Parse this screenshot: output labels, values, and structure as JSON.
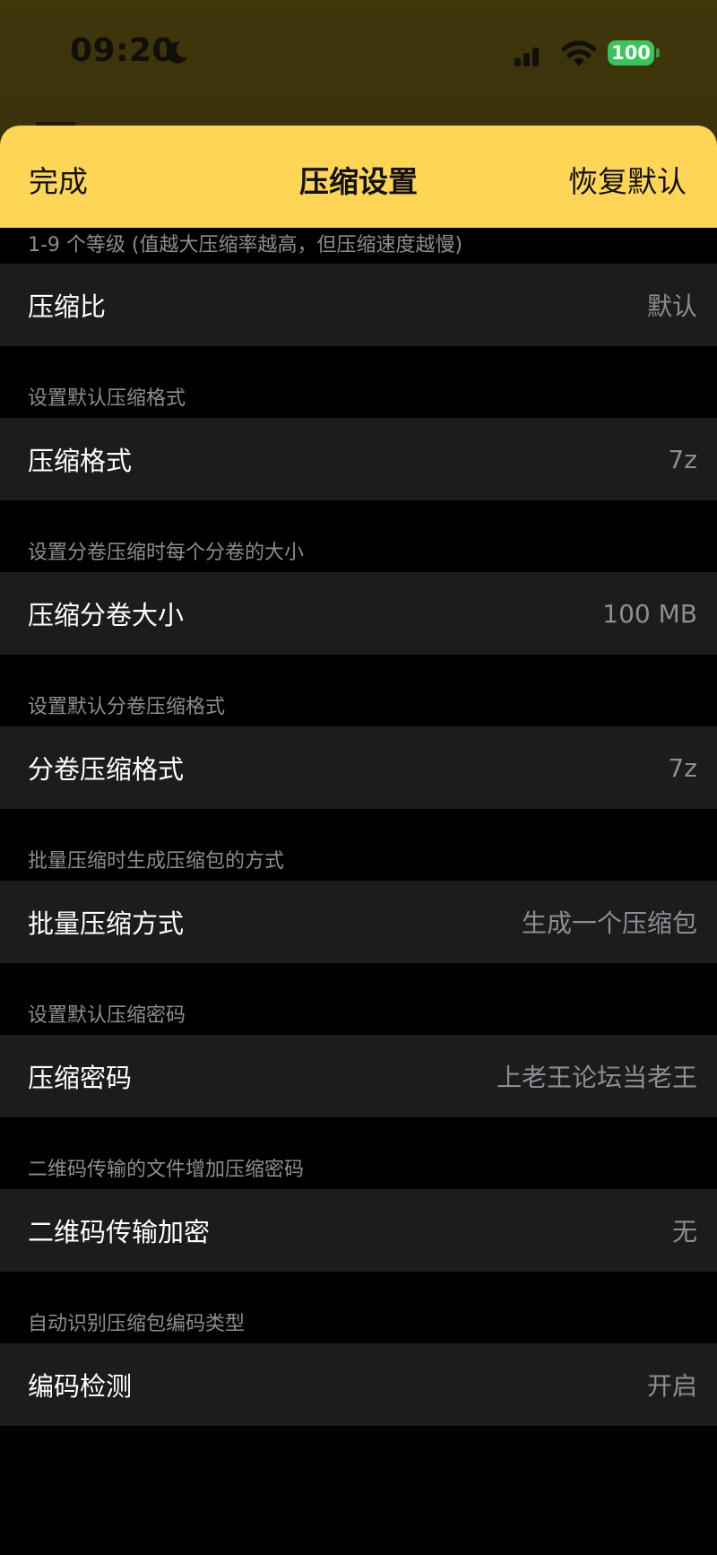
{
  "status_bar": {
    "time": "09:20",
    "battery": "100"
  },
  "nav": {
    "done_label": "完成",
    "title": "压缩设置",
    "reset_label": "恢复默认"
  },
  "settings": [
    {
      "header": "1-9 个等级 (值越大压缩率越高，但压缩速度越慢)",
      "label": "压缩比",
      "value": "默认"
    },
    {
      "header": "设置默认压缩格式",
      "label": "压缩格式",
      "value": "7z"
    },
    {
      "header": "设置分卷压缩时每个分卷的大小",
      "label": "压缩分卷大小",
      "value": "100 MB"
    },
    {
      "header": "设置默认分卷压缩格式",
      "label": "分卷压缩格式",
      "value": "7z"
    },
    {
      "header": "批量压缩时生成压缩包的方式",
      "label": "批量压缩方式",
      "value": "生成一个压缩包"
    },
    {
      "header": "设置默认压缩密码",
      "label": "压缩密码",
      "value": "上老王论坛当老王"
    },
    {
      "header": "二维码传输的文件增加压缩密码",
      "label": "二维码传输加密",
      "value": "无"
    },
    {
      "header": "自动识别压缩包编码类型",
      "label": "编码检测",
      "value": "开启"
    }
  ],
  "colors": {
    "accent": "#fed554",
    "row_background": "#1c1c1e",
    "secondary_text": "#8d8d93",
    "battery_green": "#34c759"
  },
  "icons": [
    "moon-icon",
    "cellular-signal-icon",
    "wifi-icon",
    "battery-icon"
  ]
}
